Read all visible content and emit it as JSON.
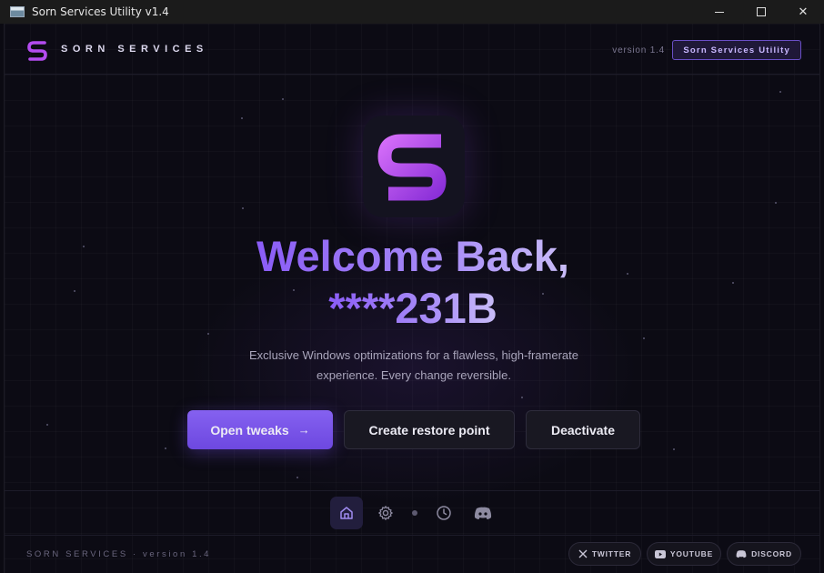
{
  "window": {
    "title": "Sorn Services Utility v1.4",
    "controls": {
      "minimize": "minimize",
      "maximize": "maximize",
      "close": "✕"
    }
  },
  "header": {
    "brand_name": "SORN SERVICES",
    "version": "version 1.4",
    "badge": "Sorn Services Utility"
  },
  "hero": {
    "welcome_line1": "Welcome Back,",
    "welcome_line2": "****231B",
    "subtitle_line1": "Exclusive Windows optimizations for a flawless, high-framerate",
    "subtitle_line2": "experience. Every change reversible."
  },
  "actions": {
    "open_tweaks": "Open tweaks",
    "open_tweaks_arrow": "→",
    "create_restore_point": "Create restore point",
    "deactivate": "Deactivate"
  },
  "nav": {
    "items": [
      {
        "icon": "home-icon",
        "active": true
      },
      {
        "icon": "gear-icon",
        "active": false
      },
      {
        "icon": "clock-icon",
        "active": false
      },
      {
        "icon": "discord-icon",
        "active": false
      }
    ]
  },
  "footer": {
    "text": "SORN SERVICES · version 1.4",
    "socials": [
      {
        "label": "TWITTER",
        "icon": "x-icon"
      },
      {
        "label": "YOUTUBE",
        "icon": "youtube-icon"
      },
      {
        "label": "DISCORD",
        "icon": "discord-icon"
      }
    ]
  },
  "colors": {
    "accent": "#8561f0",
    "logo_purple": "#b44cf0",
    "background": "#0c0b14"
  }
}
